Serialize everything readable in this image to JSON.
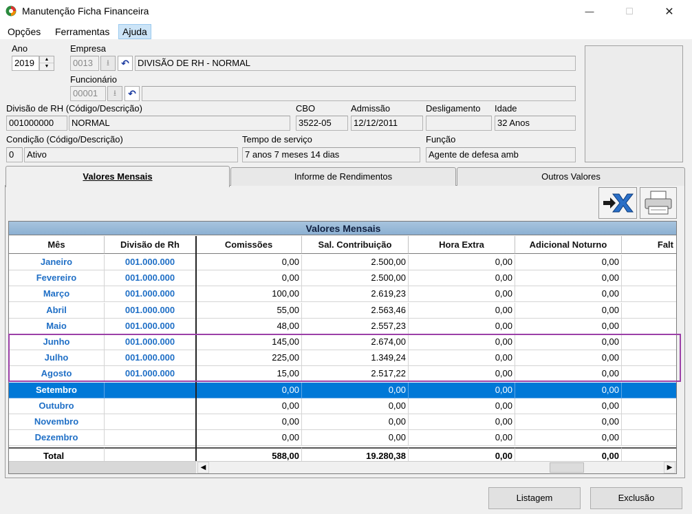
{
  "window": {
    "title": "Manutenção Ficha Financeira",
    "controls": {
      "minimize": "—",
      "maximize": "☐",
      "close": "✕"
    }
  },
  "menu": [
    "Opções",
    "Ferramentas",
    "Ajuda"
  ],
  "form": {
    "ano_label": "Ano",
    "ano_value": "2019",
    "empresa_label": "Empresa",
    "empresa_code": "0013",
    "empresa_name": "DIVISÃO DE RH - NORMAL",
    "funcionario_label": "Funcionário",
    "funcionario_code": "00001",
    "funcionario_name": "",
    "divisao_label": "Divisão de RH (Código/Descrição)",
    "divisao_code": "001000000",
    "divisao_desc": "NORMAL",
    "cbo_label": "CBO",
    "cbo_value": "3522-05",
    "admissao_label": "Admissão",
    "admissao_value": "12/12/2011",
    "desligamento_label": "Desligamento",
    "desligamento_value": "",
    "idade_label": "Idade",
    "idade_value": "32 Anos",
    "condicao_label": "Condição (Código/Descrição)",
    "condicao_code": "0",
    "condicao_desc": "Ativo",
    "tempo_label": "Tempo de serviço",
    "tempo_value": "7 anos 7 meses 14 dias",
    "funcao_label": "Função",
    "funcao_value": "Agente de defesa amb"
  },
  "tabs": [
    "Valores Mensais",
    "Informe de Rendimentos",
    "Outros Valores"
  ],
  "grid": {
    "banner": "Valores Mensais",
    "headers": [
      "Mês",
      "Divisão de Rh",
      "Comissões",
      "Sal. Contribuição",
      "Hora Extra",
      "Adicional Noturno",
      "Falt"
    ],
    "rows": [
      [
        "Janeiro",
        "001.000.000",
        "0,00",
        "2.500,00",
        "0,00",
        "0,00"
      ],
      [
        "Fevereiro",
        "001.000.000",
        "0,00",
        "2.500,00",
        "0,00",
        "0,00"
      ],
      [
        "Março",
        "001.000.000",
        "100,00",
        "2.619,23",
        "0,00",
        "0,00"
      ],
      [
        "Abril",
        "001.000.000",
        "55,00",
        "2.563,46",
        "0,00",
        "0,00"
      ],
      [
        "Maio",
        "001.000.000",
        "48,00",
        "2.557,23",
        "0,00",
        "0,00"
      ],
      [
        "Junho",
        "001.000.000",
        "145,00",
        "2.674,00",
        "0,00",
        "0,00"
      ],
      [
        "Julho",
        "001.000.000",
        "225,00",
        "1.349,24",
        "0,00",
        "0,00"
      ],
      [
        "Agosto",
        "001.000.000",
        "15,00",
        "2.517,22",
        "0,00",
        "0,00"
      ],
      [
        "Setembro",
        "",
        "0,00",
        "0,00",
        "0,00",
        "0,00"
      ],
      [
        "Outubro",
        "",
        "0,00",
        "0,00",
        "0,00",
        "0,00"
      ],
      [
        "Novembro",
        "",
        "0,00",
        "0,00",
        "0,00",
        "0,00"
      ],
      [
        "Dezembro",
        "",
        "0,00",
        "0,00",
        "0,00",
        "0,00"
      ]
    ],
    "total": [
      "Total",
      "",
      "588,00",
      "19.280,38",
      "0,00",
      "0,00"
    ],
    "selected_row": 8,
    "highlight_color": "#9b3fa7",
    "selected_color": "#0078d7"
  },
  "buttons": {
    "listagem": "Listagem",
    "exclusao": "Exclusão"
  }
}
